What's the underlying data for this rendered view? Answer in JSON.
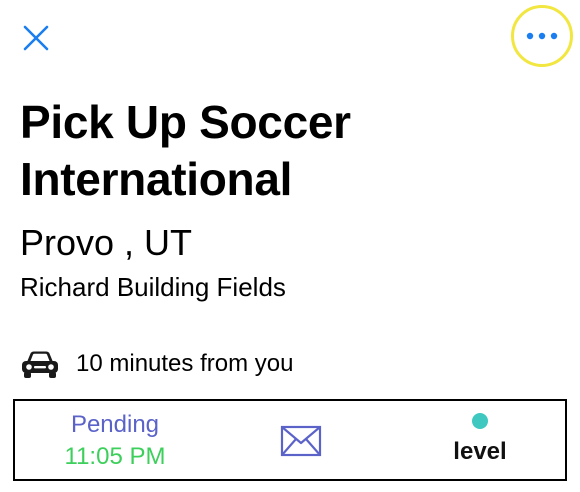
{
  "header": {
    "close_icon": "close-icon",
    "more_icon": "more-options-icon"
  },
  "event": {
    "title": "Pick Up Soccer International",
    "city": "Provo , UT",
    "venue": "Richard Building Fields",
    "distance": "10 minutes from you",
    "distance_icon": "car-icon"
  },
  "bottom_bar": {
    "status": "Pending",
    "time": "11:05 PM",
    "message_icon": "mail-icon",
    "level_label": "level",
    "level_dot_color": "#3ec8c0"
  },
  "colors": {
    "accent_blue": "#1a7ef0",
    "highlight_ring": "#f2e640",
    "pending_text": "#5b63c9",
    "time_text": "#3dcf5b",
    "mail_icon": "#5b63c9"
  }
}
